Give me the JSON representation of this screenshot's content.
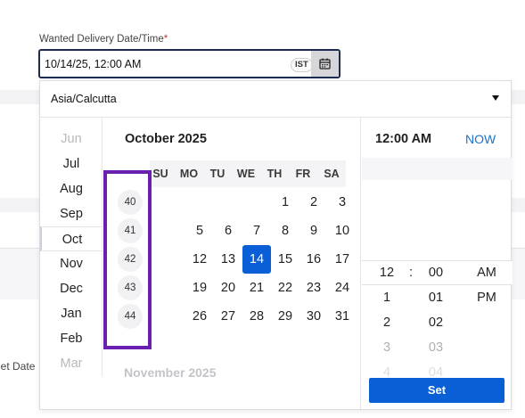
{
  "field": {
    "label": "Wanted Delivery Date/Time",
    "required_mark": "*",
    "value": "10/14/25, 12:00 AM",
    "tz_badge": "IST",
    "calendar_icon": "calendar-icon"
  },
  "background": {
    "partial_label": "get Date"
  },
  "timezone": {
    "value": "Asia/Calcutta"
  },
  "months": [
    {
      "label": "Jun",
      "state": "faded"
    },
    {
      "label": "Jul",
      "state": "normal"
    },
    {
      "label": "Aug",
      "state": "normal"
    },
    {
      "label": "Sep",
      "state": "normal"
    },
    {
      "label": "Oct",
      "state": "selected"
    },
    {
      "label": "Nov",
      "state": "normal"
    },
    {
      "label": "Dec",
      "state": "normal"
    },
    {
      "label": "Jan",
      "state": "normal"
    },
    {
      "label": "Feb",
      "state": "normal"
    },
    {
      "label": "Mar",
      "state": "faded"
    }
  ],
  "calendar": {
    "month_title": "October 2025",
    "next_month_title": "November 2025",
    "weekdays": [
      "SU",
      "MO",
      "TU",
      "WE",
      "TH",
      "FR",
      "SA"
    ],
    "weeks": [
      {
        "number": "40",
        "days": [
          "",
          "",
          "",
          "1",
          "2",
          "3",
          "4"
        ]
      },
      {
        "number": "41",
        "days": [
          "5",
          "6",
          "7",
          "8",
          "9",
          "10",
          "11"
        ]
      },
      {
        "number": "42",
        "days": [
          "12",
          "13",
          "14",
          "15",
          "16",
          "17",
          "18"
        ]
      },
      {
        "number": "43",
        "days": [
          "19",
          "20",
          "21",
          "22",
          "23",
          "24",
          "25"
        ]
      },
      {
        "number": "44",
        "days": [
          "26",
          "27",
          "28",
          "29",
          "30",
          "31",
          ""
        ]
      }
    ],
    "selected_day": "14"
  },
  "time": {
    "current_label": "12:00 AM",
    "now_label": "NOW",
    "separator": ":",
    "hours": [
      "12",
      "1",
      "2",
      "3",
      "4"
    ],
    "minutes": [
      "00",
      "01",
      "02",
      "03",
      "04"
    ],
    "meridiem": [
      "AM",
      "PM"
    ],
    "set_label": "Set"
  },
  "colors": {
    "accent": "#0b5fd6",
    "highlight_box": "#6a1fb0",
    "now_link": "#1a73c9",
    "required": "#c23934"
  }
}
